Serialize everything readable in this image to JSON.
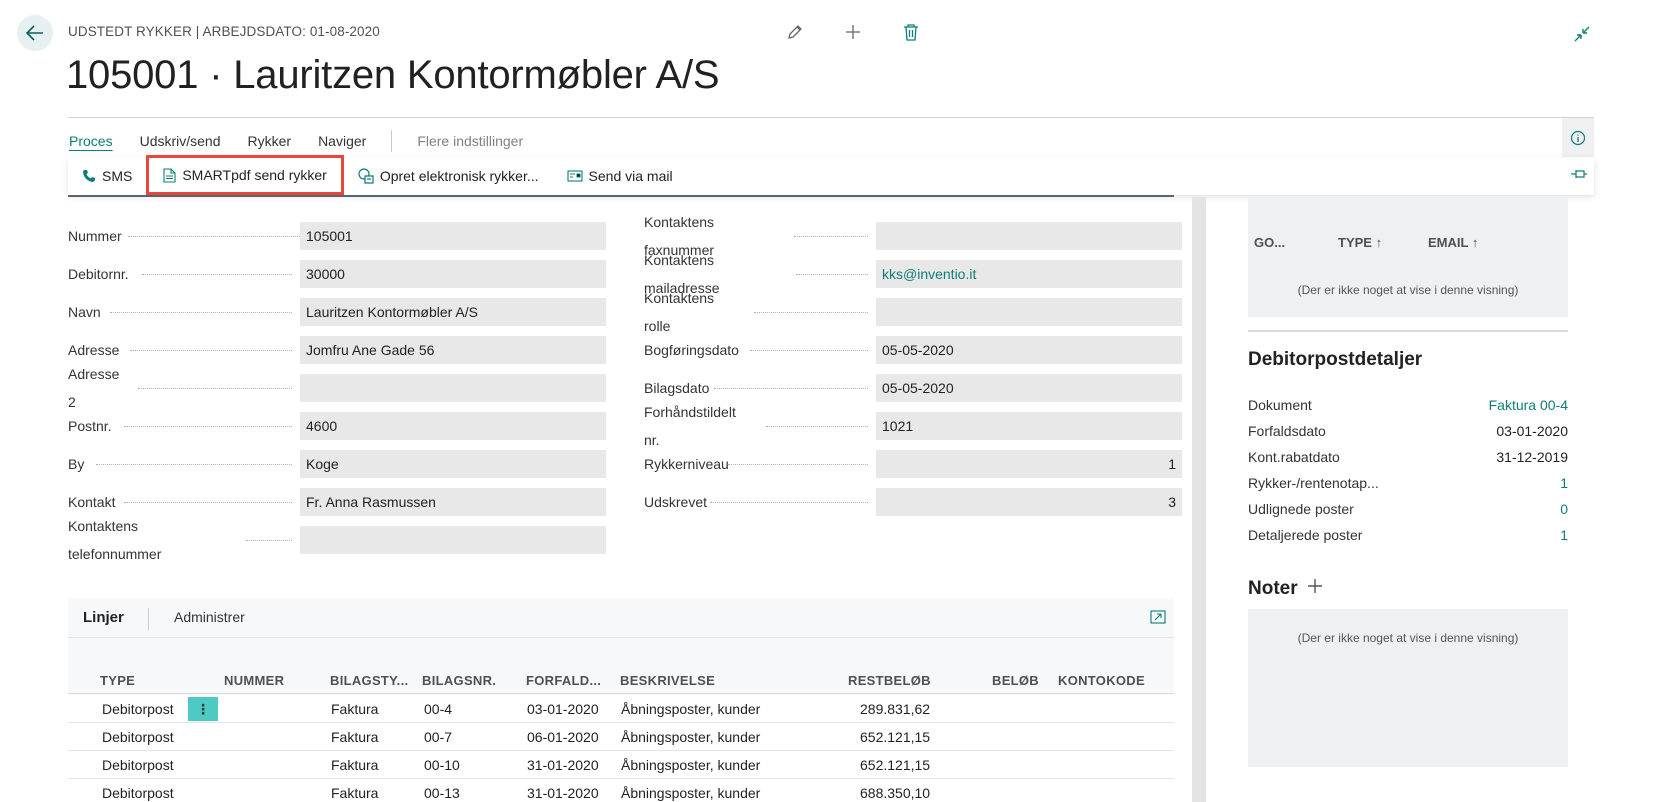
{
  "header": {
    "caption": "UDSTEDT RYKKER | ARBEJDSDATO: 01-08-2020",
    "title": "105001 · Lauritzen Kontormøbler A/S"
  },
  "actionbar": {
    "menus": [
      "Proces",
      "Udskriv/send",
      "Rykker",
      "Naviger"
    ],
    "more": "Flere indstillinger"
  },
  "subactions": {
    "sms": "SMS",
    "smartpdf": "SMARTpdf send rykker",
    "electronic": "Opret elektronisk rykker...",
    "mail": "Send via mail"
  },
  "form_left": [
    {
      "label": "Nummer",
      "value": "105001"
    },
    {
      "label": "Debitornr.",
      "value": "30000"
    },
    {
      "label": "Navn",
      "value": "Lauritzen Kontormøbler A/S"
    },
    {
      "label": "Adresse",
      "value": "Jomfru Ane Gade 56"
    },
    {
      "label": "Adresse 2",
      "value": ""
    },
    {
      "label": "Postnr.",
      "value": "4600"
    },
    {
      "label": "By",
      "value": "Koge"
    },
    {
      "label": "Kontakt",
      "value": "Fr. Anna Rasmussen"
    },
    {
      "label": "Kontaktens telefonnummer",
      "value": ""
    }
  ],
  "form_right": [
    {
      "label": "Kontaktens faxnummer",
      "value": ""
    },
    {
      "label": "Kontaktens mailadresse",
      "value": "kks@inventio.it"
    },
    {
      "label": "Kontaktens rolle",
      "value": ""
    },
    {
      "label": "Bogføringsdato",
      "value": "05-05-2020"
    },
    {
      "label": "Bilagsdato",
      "value": "05-05-2020"
    },
    {
      "label": "Forhåndstildelt nr.",
      "value": "1021"
    },
    {
      "label": "Rykkerniveau",
      "value": "1"
    },
    {
      "label": "Udskrevet",
      "value": "3"
    }
  ],
  "lines": {
    "tab": "Linjer",
    "manage": "Administrer",
    "columns": [
      "TYPE",
      "NUMMER",
      "BILAGSTY...",
      "BILAGSNR.",
      "FORFALD...",
      "BESKRIVELSE",
      "RESTBELØB",
      "BELØB",
      "KONTOKODE"
    ],
    "rows": [
      {
        "type": "Debitorpost",
        "doctype": "Faktura",
        "docno": "00-4",
        "due": "03-01-2020",
        "desc": "Åbningsposter, kunder",
        "rest": "289.831,62"
      },
      {
        "type": "Debitorpost",
        "doctype": "Faktura",
        "docno": "00-7",
        "due": "06-01-2020",
        "desc": "Åbningsposter, kunder",
        "rest": "652.121,15"
      },
      {
        "type": "Debitorpost",
        "doctype": "Faktura",
        "docno": "00-10",
        "due": "31-01-2020",
        "desc": "Åbningsposter, kunder",
        "rest": "652.121,15"
      },
      {
        "type": "Debitorpost",
        "doctype": "Faktura",
        "docno": "00-13",
        "due": "31-01-2020",
        "desc": "Åbningsposter, kunder",
        "rest": "688.350,10"
      }
    ]
  },
  "side": {
    "cols": [
      "GO...",
      "TYPE ↑",
      "EMAIL ↑"
    ],
    "empty": "(Der er ikke noget at vise i denne visning)",
    "details_title": "Debitorpostdetaljer",
    "details": [
      {
        "k": "Dokument",
        "v": "Faktura 00-4",
        "link": true
      },
      {
        "k": "Forfaldsdato",
        "v": "03-01-2020",
        "link": false
      },
      {
        "k": "Kont.rabatdato",
        "v": "31-12-2019",
        "link": false
      },
      {
        "k": "Rykker-/rentenotap...",
        "v": "1",
        "link": true
      },
      {
        "k": "Udlignede poster",
        "v": "0",
        "link": true
      },
      {
        "k": "Detaljerede poster",
        "v": "1",
        "link": true
      }
    ],
    "notes_title": "Noter",
    "notes_empty": "(Der er ikke noget at vise i denne visning)"
  },
  "colors": {
    "accent": "#0e7d76",
    "highlight": "#e8473c",
    "row_menu": "#4ec9c4"
  }
}
